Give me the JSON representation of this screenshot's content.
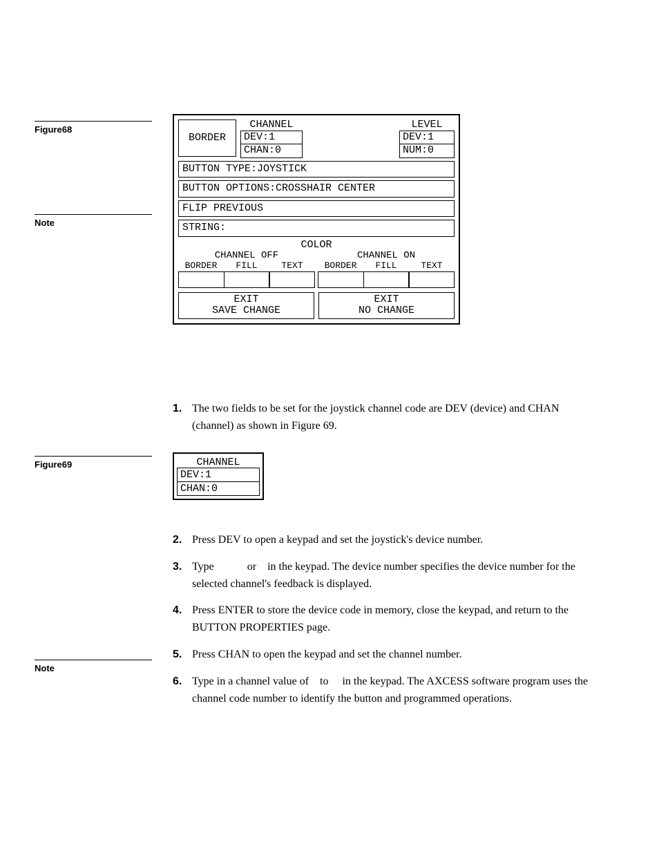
{
  "labels": {
    "figure68": "Figure68",
    "note1": "Note",
    "figure69": "Figure69",
    "note2": "Note"
  },
  "panel68": {
    "border": "BORDER",
    "channel_title": "CHANNEL",
    "dev1": "DEV:1",
    "chan0": "CHAN:0",
    "level_title": "LEVEL",
    "lev_dev": "DEV:1",
    "lev_num": "NUM:0",
    "btn_type": "BUTTON TYPE:JOYSTICK",
    "btn_opts": "BUTTON OPTIONS:CROSSHAIR CENTER",
    "flip": "FLIP  PREVIOUS",
    "string": "STRING:",
    "color_title": "COLOR",
    "chan_off": "CHANNEL OFF",
    "chan_on": "CHANNEL ON",
    "col_border": "BORDER",
    "col_fill": "FILL",
    "col_text": "TEXT",
    "exit_save1": "EXIT",
    "exit_save2": "SAVE CHANGE",
    "exit_no1": "EXIT",
    "exit_no2": "NO CHANGE"
  },
  "panel69": {
    "title": "CHANNEL",
    "dev": "DEV:1",
    "chan": "CHAN:0"
  },
  "steps1": {
    "n1": "1.",
    "t1": "The two fields to be set for the joystick channel code are DEV (device) and CHAN (channel) as shown in Figure 69."
  },
  "steps2": {
    "n2": "2.",
    "t2": "Press DEV to open a keypad and set the joystick's device number.",
    "n3": "3.",
    "t3": "Type            or    in the keypad. The device number specifies the device number for the selected channel's feedback is displayed.",
    "n4": "4.",
    "t4": "Press ENTER to store the device code in memory, close the keypad, and return to the BUTTON PROPERTIES page.",
    "n5": "5.",
    "t5": "Press CHAN to open the keypad and set the channel number.",
    "n6": "6.",
    "t6": "Type in a channel value of    to     in the keypad. The AXCESS software program uses the channel code number to identify the button and programmed operations."
  }
}
